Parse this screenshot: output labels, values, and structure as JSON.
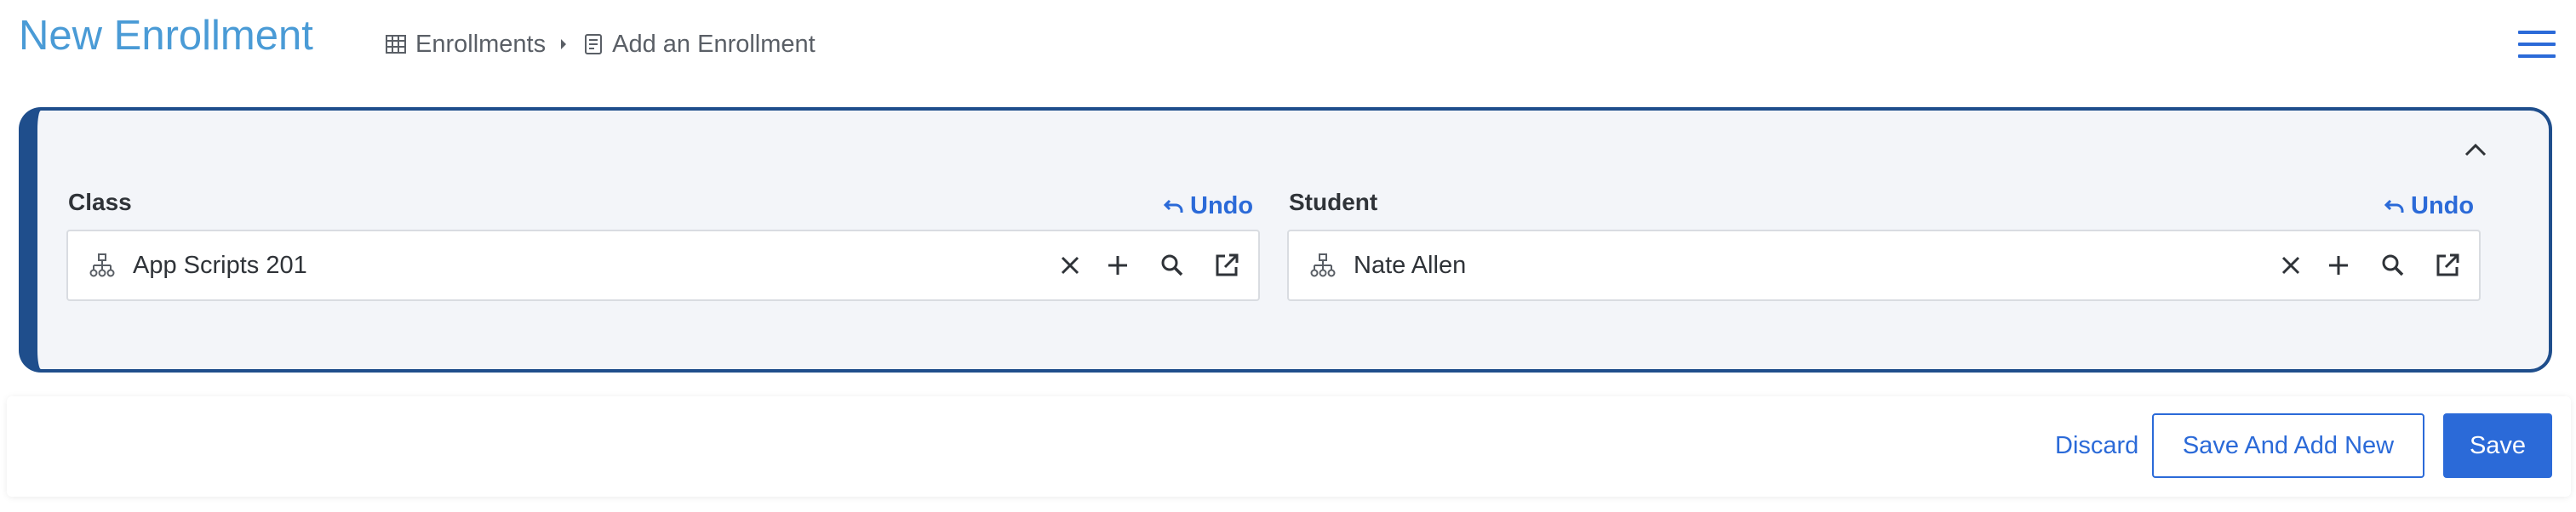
{
  "header": {
    "title": "New Enrollment",
    "breadcrumb": [
      {
        "label": "Enrollments",
        "icon": "table-icon"
      },
      {
        "label": "Add an Enrollment",
        "icon": "form-icon"
      }
    ],
    "menu_icon": "hamburger-menu-icon"
  },
  "form": {
    "collapse_icon": "chevron-up-icon",
    "fields": [
      {
        "label": "Class",
        "value": "App Scripts 201",
        "undo_label": "Undo"
      },
      {
        "label": "Student",
        "value": "Nate Allen",
        "undo_label": "Undo"
      }
    ],
    "field_actions": [
      "clear-icon",
      "add-icon",
      "search-icon",
      "open-external-icon"
    ]
  },
  "footer": {
    "discard_label": "Discard",
    "save_and_add_new_label": "Save And Add New",
    "save_label": "Save"
  },
  "colors": {
    "title": "#4a9bd6",
    "accent": "#2b6ad8",
    "panel_border": "#1f4e8c",
    "panel_background": "#f3f5f9"
  }
}
